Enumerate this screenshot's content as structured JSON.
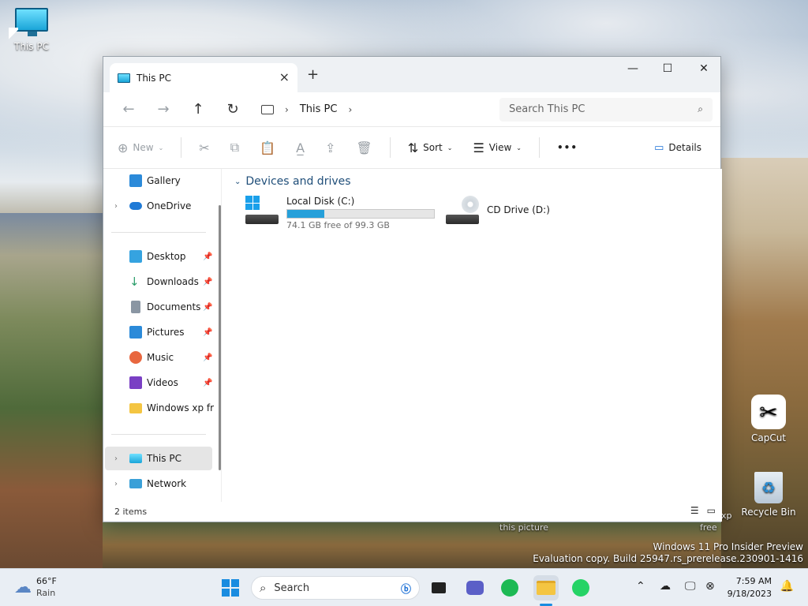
{
  "desktop": {
    "icons": [
      {
        "label": "This PC"
      },
      {
        "label": "CapCut"
      },
      {
        "label": "Recycle Bin"
      }
    ],
    "floating_labels": [
      "this picture",
      "xp",
      "free"
    ],
    "watermark": {
      "line1": "Windows 11 Pro Insider Preview",
      "line2": "Evaluation copy. Build 25947.rs_prerelease.230901-1416"
    }
  },
  "explorer": {
    "tab_title": "This PC",
    "new_tab": "+",
    "window_controls": {
      "minimize": "—",
      "maximize": "☐",
      "close": "✕"
    },
    "breadcrumb": {
      "location": "This PC"
    },
    "search_placeholder": "Search This PC",
    "toolbar": {
      "new": "New",
      "sort": "Sort",
      "view": "View",
      "more": "•••",
      "details": "Details"
    },
    "nav": {
      "gallery": "Gallery",
      "onedrive": "OneDrive",
      "desktop": "Desktop",
      "downloads": "Downloads",
      "documents": "Documents",
      "pictures": "Pictures",
      "music": "Music",
      "videos": "Videos",
      "folder": "Windows xp free",
      "this_pc": "This PC",
      "network": "Network"
    },
    "section_title": "Devices and drives",
    "drives": [
      {
        "name": "Local Disk (C:)",
        "free_text": "74.1 GB free of 99.3 GB",
        "used_fraction": 0.254
      },
      {
        "name": "CD Drive (D:)"
      }
    ],
    "status": "2 items"
  },
  "taskbar": {
    "weather_temp": "66°F",
    "weather_desc": "Rain",
    "search_label": "Search",
    "time": "7:59 AM",
    "date": "9/18/2023"
  },
  "colors": {
    "accent": "#1a8ce0",
    "progress": "#26a0da",
    "section_header": "#1f4e79"
  }
}
